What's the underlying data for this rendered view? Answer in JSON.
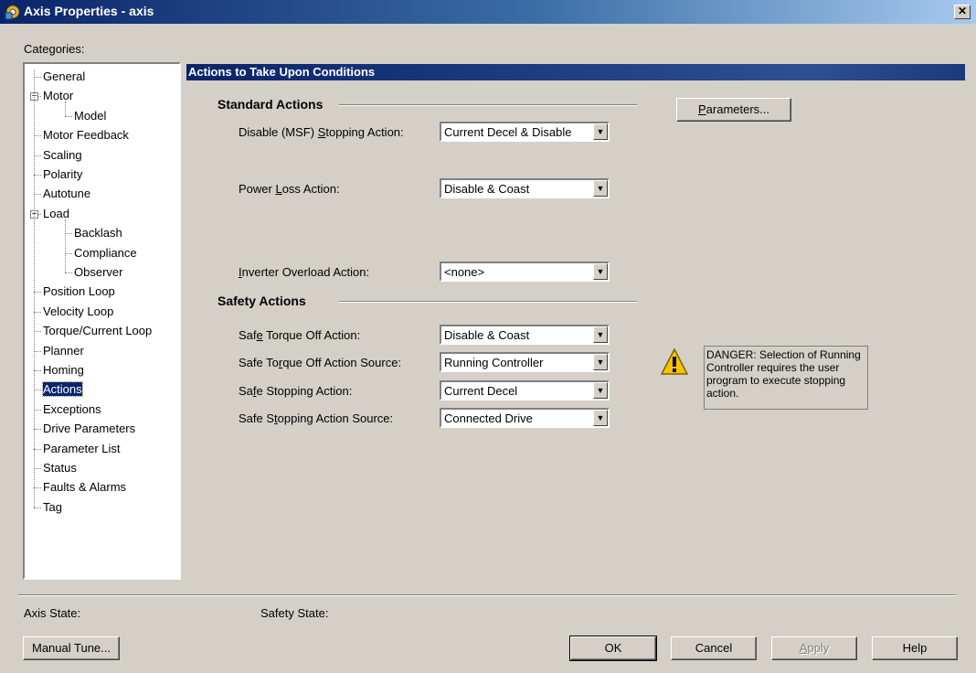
{
  "window": {
    "title": "Axis Properties - axis",
    "close_glyph": "✕"
  },
  "categories": {
    "label": "Categories:",
    "items": [
      {
        "label": "General",
        "level": 0
      },
      {
        "label": "Motor",
        "level": 0,
        "expander": "−"
      },
      {
        "label": "Model",
        "level": 1
      },
      {
        "label": "Motor Feedback",
        "level": 0
      },
      {
        "label": "Scaling",
        "level": 0
      },
      {
        "label": "Polarity",
        "level": 0
      },
      {
        "label": "Autotune",
        "level": 0
      },
      {
        "label": "Load",
        "level": 0,
        "expander": "−"
      },
      {
        "label": "Backlash",
        "level": 1
      },
      {
        "label": "Compliance",
        "level": 1
      },
      {
        "label": "Observer",
        "level": 1
      },
      {
        "label": "Position Loop",
        "level": 0
      },
      {
        "label": "Velocity Loop",
        "level": 0
      },
      {
        "label": "Torque/Current Loop",
        "level": 0
      },
      {
        "label": "Planner",
        "level": 0
      },
      {
        "label": "Homing",
        "level": 0
      },
      {
        "label": "Actions",
        "level": 0,
        "selected": true
      },
      {
        "label": "Exceptions",
        "level": 0
      },
      {
        "label": "Drive Parameters",
        "level": 0
      },
      {
        "label": "Parameter List",
        "level": 0
      },
      {
        "label": "Status",
        "level": 0
      },
      {
        "label": "Faults & Alarms",
        "level": 0
      },
      {
        "label": "Tag",
        "level": 0
      }
    ]
  },
  "main": {
    "header": "Actions to Take Upon Conditions",
    "standard_actions": {
      "title": "Standard Actions",
      "disable_msf": {
        "label_pre": "Disable (MSF) ",
        "label_u": "S",
        "label_post": "topping Action:",
        "value": "Current Decel & Disable"
      },
      "power_loss": {
        "label_pre": "Power ",
        "label_u": "L",
        "label_post": "oss Action:",
        "value": "Disable & Coast"
      },
      "inverter_overload": {
        "label_pre": "",
        "label_u": "I",
        "label_post": "nverter Overload Action:",
        "value": "<none>"
      }
    },
    "safety_actions": {
      "title": "Safety Actions",
      "safe_torque_off": {
        "label_pre": "Saf",
        "label_u": "e",
        "label_post": " Torque Off Action:",
        "value": "Disable & Coast"
      },
      "safe_torque_off_source": {
        "label_pre": "Safe To",
        "label_u": "r",
        "label_post": "que Off Action Source:",
        "value": "Running Controller"
      },
      "safe_stopping": {
        "label_pre": "Sa",
        "label_u": "f",
        "label_post": "e Stopping Action:",
        "value": "Current Decel"
      },
      "safe_stopping_source": {
        "label_pre": "Safe S",
        "label_u": "t",
        "label_post": "opping Action Source:",
        "value": "Connected Drive"
      }
    },
    "parameters_button": {
      "label_u": "P",
      "label_post": "arameters..."
    },
    "warning": {
      "text": "DANGER: Selection of Running Controller requires the user program to execute stopping action.",
      "icon": "warning-triangle-icon"
    }
  },
  "status": {
    "axis_state_label": "Axis State:",
    "safety_state_label": "Safety State:"
  },
  "buttons": {
    "manual_tune": "Manual Tune...",
    "ok": "OK",
    "cancel": "Cancel",
    "apply_u": "A",
    "apply_post": "pply",
    "help": "Help"
  },
  "colors": {
    "titlebar_start": "#0a246a",
    "selection": "#0a246a",
    "warning_yellow": "#f5c400",
    "dialog_bg": "#d4d0c8"
  }
}
